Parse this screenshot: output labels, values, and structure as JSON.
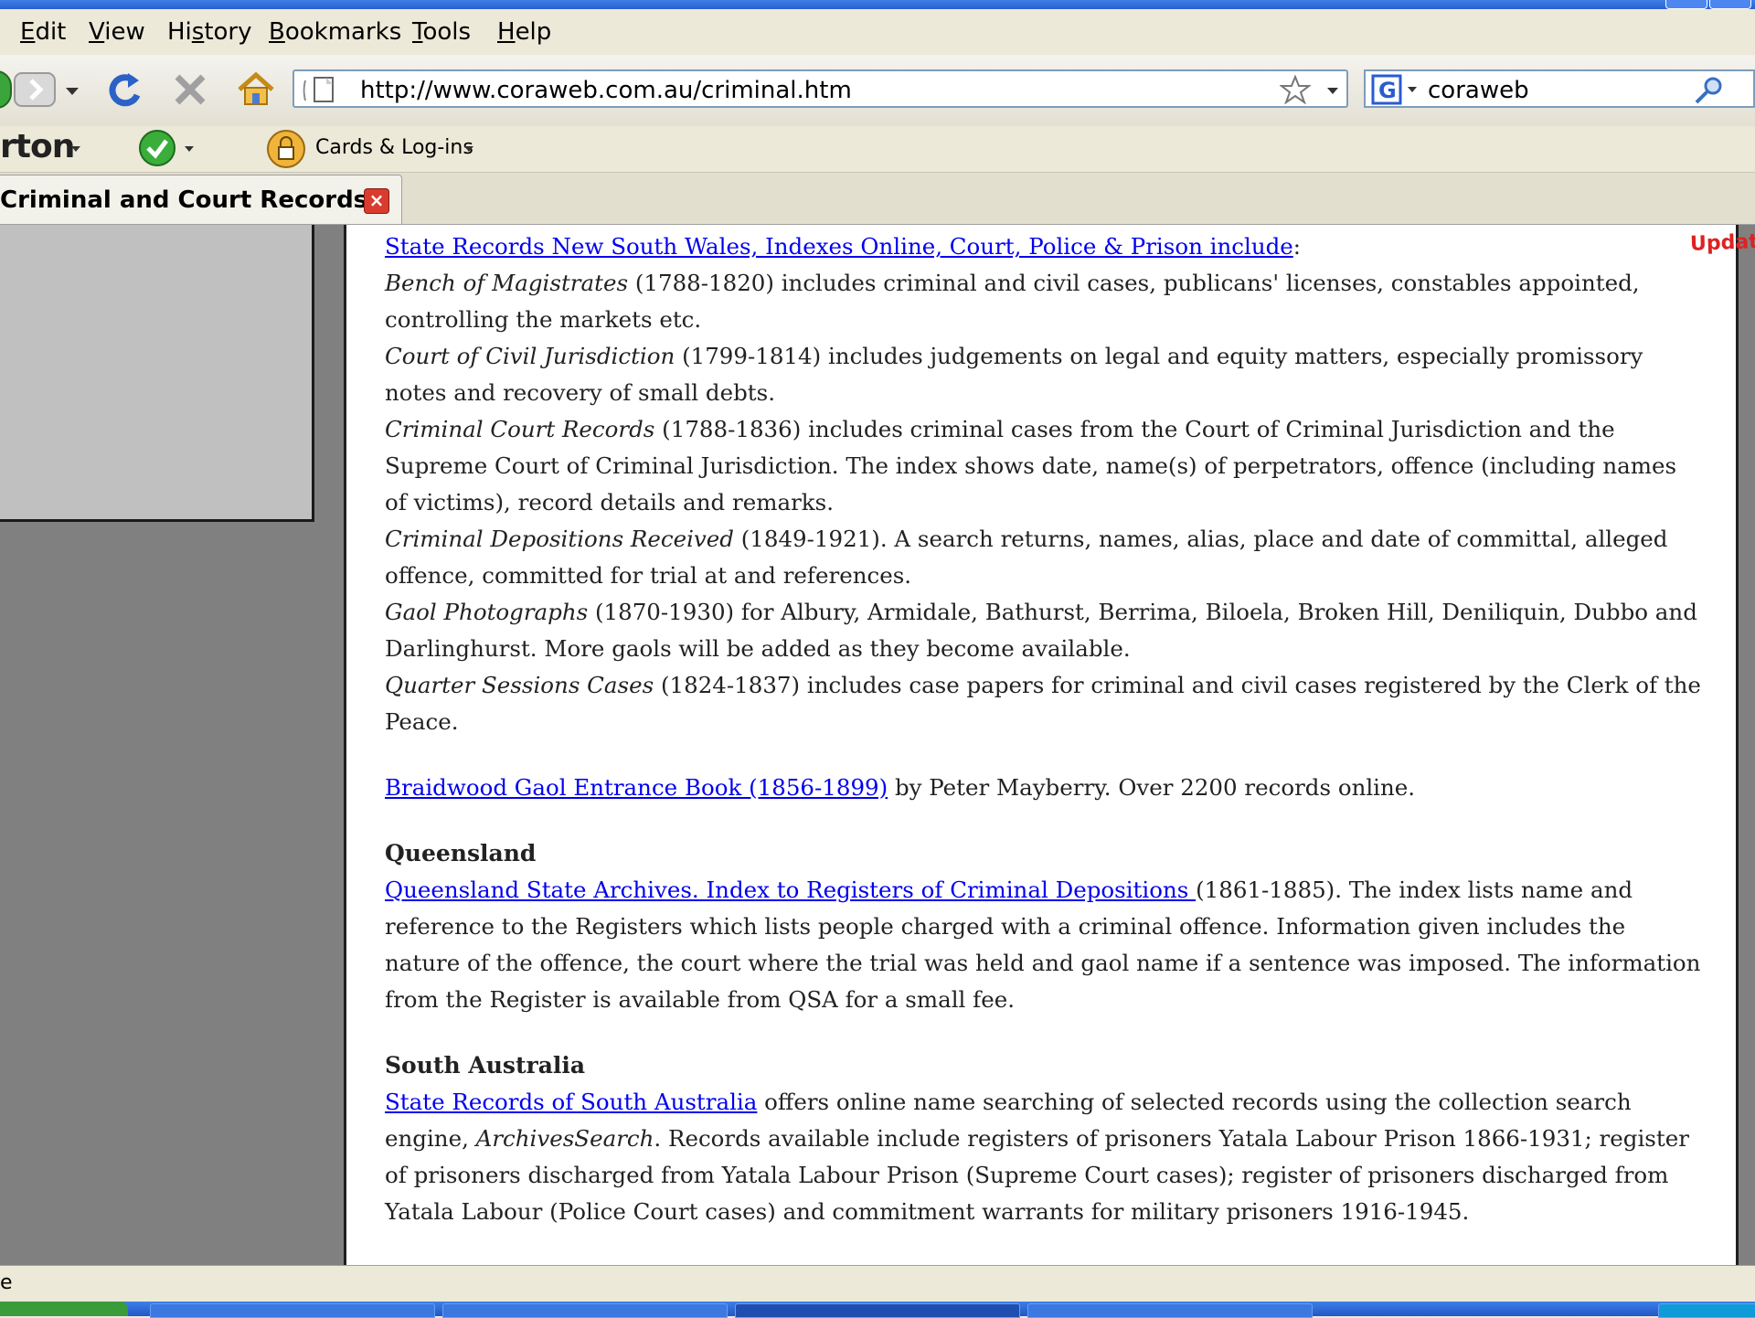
{
  "menu": {
    "items": [
      "Edit",
      "View",
      "History",
      "Bookmarks",
      "Tools",
      "Help"
    ]
  },
  "toolbar": {
    "url": "http://www.coraweb.com.au/criminal.htm",
    "search_value": "coraweb"
  },
  "addon_bar": {
    "norton_label": "rton",
    "cards_label": "Cards & Log-ins"
  },
  "tab": {
    "title": "Criminal and Court Records"
  },
  "content": {
    "updated_badge": "Updated",
    "nsw_link": "State Records New South Wales, Indexes Online, Court, Police & Prison include",
    "nsw_colon": ":",
    "entries": [
      {
        "title": "Bench of Magistrates",
        "text": " (1788-1820) includes criminal and civil cases, publicans' licenses, constables appointed, controlling the markets etc."
      },
      {
        "title": "Court of Civil Jurisdiction",
        "text": " (1799-1814) includes judgements on legal and equity matters, especially promissory notes and recovery of small debts."
      },
      {
        "title": "Criminal Court Records",
        "text": " (1788-1836) includes criminal cases from the Court of Criminal Jurisdiction and the Supreme Court of Criminal Jurisdiction. The index shows date, name(s) of perpetrators, offence (including names of victims), record details and remarks."
      },
      {
        "title": "Criminal Depositions Received",
        "text": " (1849-1921). A search returns, names, alias, place and date of committal, alleged offence, committed for trial at and references."
      },
      {
        "title": "Gaol Photographs",
        "text": " (1870-1930) for Albury, Armidale, Bathurst, Berrima, Biloela, Broken Hill, Deniliquin, Dubbo and Darlinghurst. More gaols will be added as they become available."
      },
      {
        "title": "Quarter Sessions Cases",
        "text": " (1824-1837) includes case papers for criminal and civil cases registered by the Clerk of the Peace."
      }
    ],
    "braidwood_link": "Braidwood Gaol Entrance Book (1856-1899)",
    "braidwood_text": " by Peter Mayberry. Over 2200 records online.",
    "qld_heading": "Queensland",
    "qld_link": "Queensland State Archives. Index to Registers of Criminal Depositions ",
    "qld_text": "(1861-1885). The index lists name and reference to the Registers which lists people charged with a criminal offence. Information given includes the nature of the offence, the court where the trial was held and gaol name if a sentence was imposed. The information from the Register is available from QSA for a small fee.",
    "sa_heading": "South Australia",
    "sa_link": "State Records of South Australia",
    "sa_text1": " offers online name searching of selected records using the collection search engine, ",
    "sa_italic": "ArchivesSearch",
    "sa_text2": ". Records available include registers of prisoners Yatala Labour Prison 1866-1931; register of prisoners discharged from Yatala Labour Prison (Supreme Court cases); register of prisoners discharged from Yatala Labour (Police Court cases) and commitment warrants for military prisoners 1916-1945."
  },
  "status": {
    "text": "e"
  }
}
